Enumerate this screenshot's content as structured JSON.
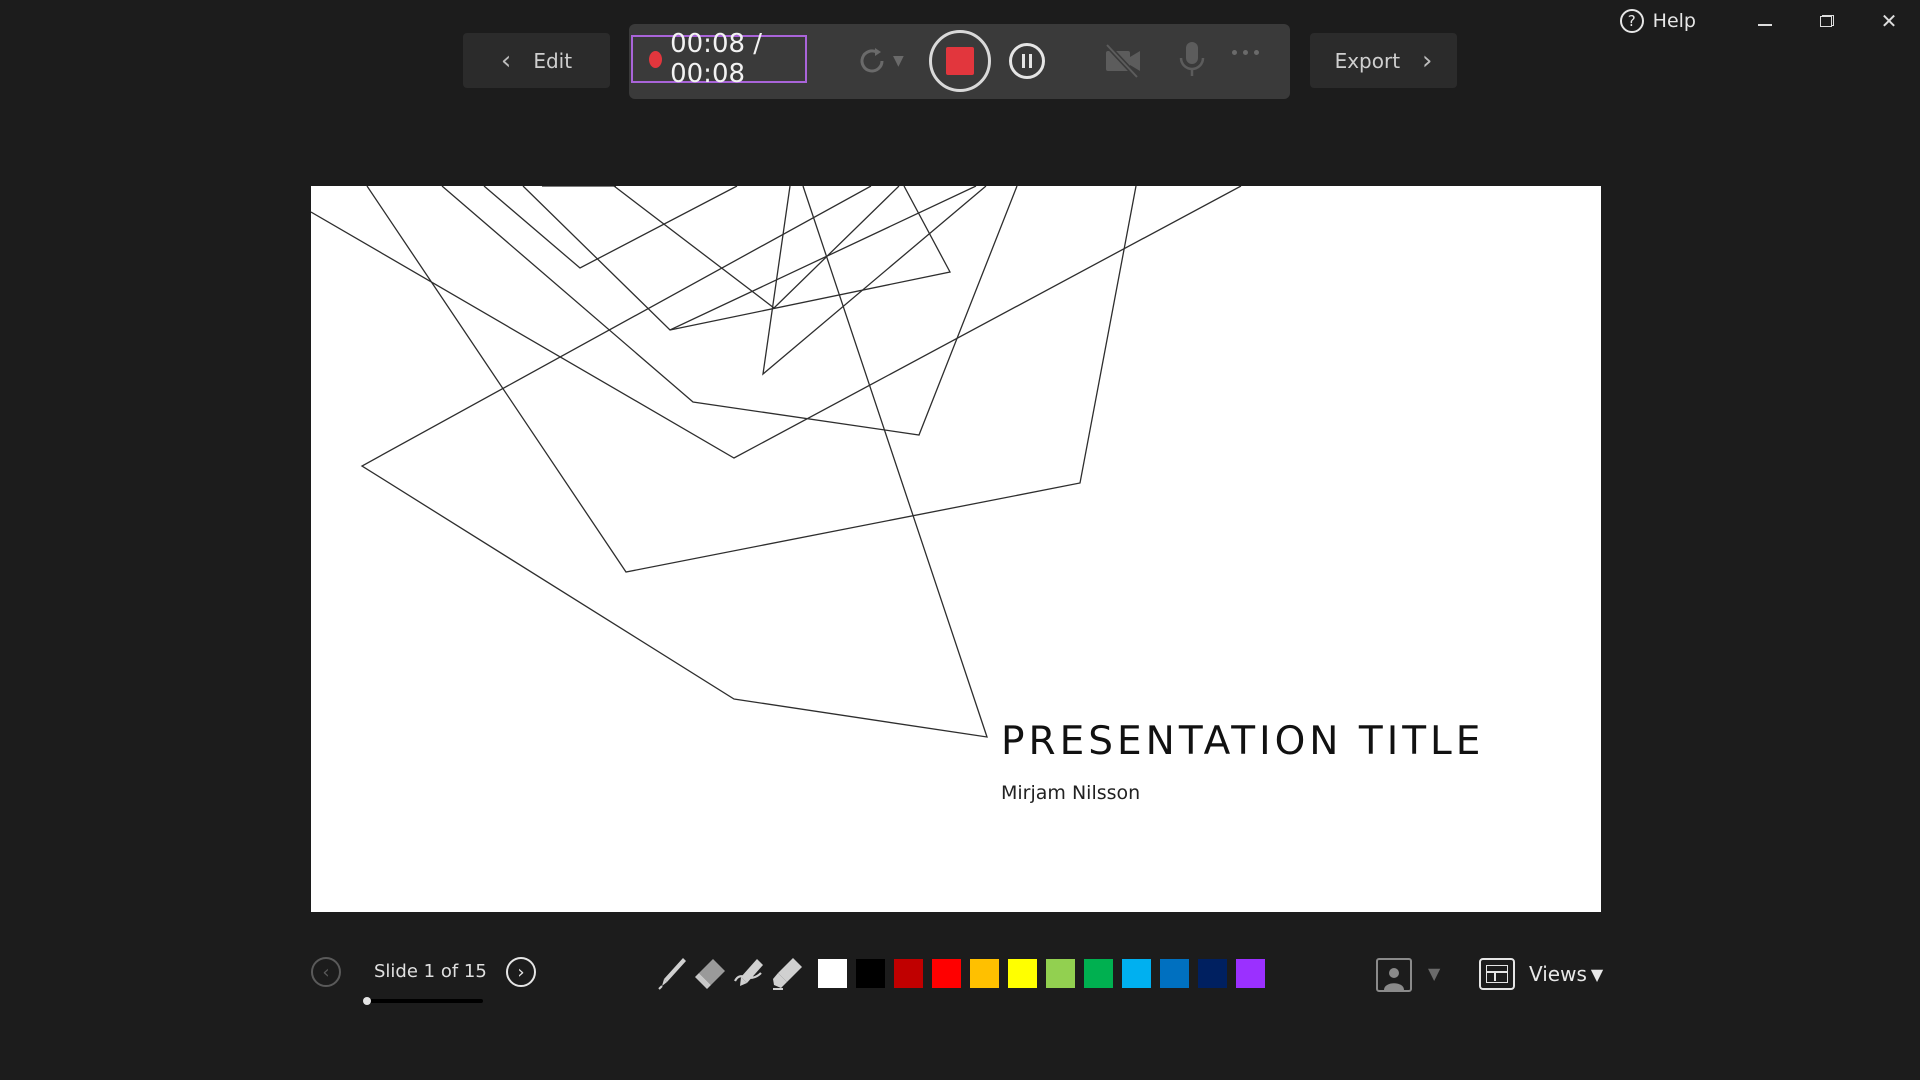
{
  "window": {
    "help_label": "Help",
    "help_icon": "?"
  },
  "toolbar": {
    "edit_label": "Edit",
    "export_label": "Export",
    "timer": "00:08 / 00:08",
    "accent_color": "#a964d9",
    "record_color": "#e2363d"
  },
  "slide": {
    "title": "PRESENTATION TITLE",
    "subtitle": "Mirjam Nilsson"
  },
  "navigation": {
    "slide_counter": "Slide 1 of 15",
    "current_slide": 1,
    "total_slides": 15
  },
  "ink_tools": [
    "pen-icon",
    "eraser-icon",
    "laser-pointer-icon",
    "highlighter-icon"
  ],
  "palette": [
    {
      "name": "white",
      "color": "#ffffff"
    },
    {
      "name": "black",
      "color": "#000000"
    },
    {
      "name": "dark-red",
      "color": "#c00000"
    },
    {
      "name": "red",
      "color": "#ff0000"
    },
    {
      "name": "orange",
      "color": "#ffc000"
    },
    {
      "name": "yellow",
      "color": "#ffff00"
    },
    {
      "name": "light-green",
      "color": "#92d050"
    },
    {
      "name": "green",
      "color": "#00b050"
    },
    {
      "name": "light-blue",
      "color": "#00b0f0"
    },
    {
      "name": "blue",
      "color": "#0070c0"
    },
    {
      "name": "dark-blue",
      "color": "#002060"
    },
    {
      "name": "purple",
      "color": "#9b30ff"
    }
  ],
  "views": {
    "label": "Views",
    "dropdown_icon": "▼"
  }
}
